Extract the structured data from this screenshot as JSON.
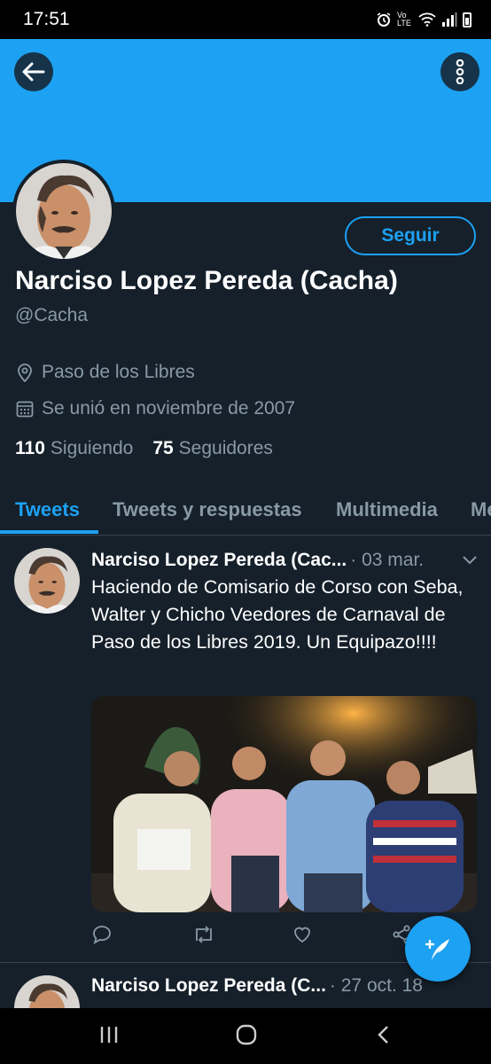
{
  "status_bar": {
    "time": "17:51",
    "network": "Vo LTE"
  },
  "profile": {
    "follow_label": "Seguir",
    "name": "Narciso Lopez Pereda (Cacha)",
    "handle": "@Cacha",
    "location": "Paso de los Libres",
    "joined": "Se unió en noviembre de 2007",
    "following_count": "110",
    "following_label": "Siguiendo",
    "followers_count": "75",
    "followers_label": "Seguidores"
  },
  "tabs": [
    {
      "label": "Tweets",
      "active": true
    },
    {
      "label": "Tweets y respuestas",
      "active": false
    },
    {
      "label": "Multimedia",
      "active": false
    },
    {
      "label": "Me",
      "active": false
    }
  ],
  "tweets": [
    {
      "author": "Narciso Lopez Pereda (Cac...",
      "date": "· 03 mar.",
      "text": "Haciendo de Comisario de Corso con Seba, Walter y Chicho Veedores de Carnaval de Paso de los Libres 2019. Un Equipazo!!!!",
      "has_photo": true
    },
    {
      "author": "Narciso Lopez Pereda (C...",
      "date": "· 27 oct. 18",
      "text": "",
      "has_photo": false
    }
  ],
  "icons": {
    "back": "arrow-left-icon",
    "more": "more-vertical-icon",
    "location": "location-pin-icon",
    "calendar": "calendar-icon",
    "reply": "reply-icon",
    "retweet": "retweet-icon",
    "like": "heart-icon",
    "share": "share-icon",
    "compose": "compose-tweet-icon"
  },
  "colors": {
    "background": "#15202b",
    "accent": "#1da1f2",
    "secondary_text": "#8899a6",
    "divider": "#38444d"
  }
}
